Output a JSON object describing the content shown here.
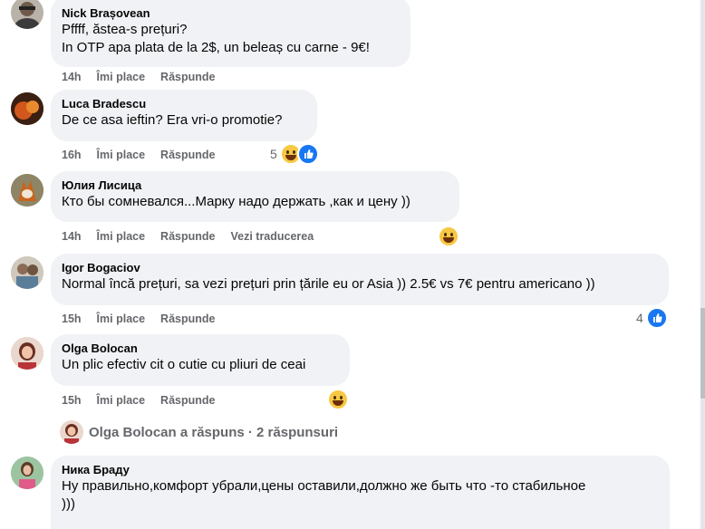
{
  "comments": [
    {
      "author": "Nick Brașovean",
      "lines": [
        "Pffff, ăstea-s prețuri?",
        "In OTP apa plata de la 2$, un beleaș cu carne - 9€!"
      ],
      "time": "14h",
      "like": "Îmi place",
      "reply": "Răspunde"
    },
    {
      "author": "Luca Bradescu",
      "lines": [
        "De ce asa ieftin? Era vri-o promotie?"
      ],
      "time": "16h",
      "like": "Îmi place",
      "reply": "Răspunde",
      "reaction_count": "5"
    },
    {
      "author": "Юлия Лисица",
      "lines": [
        "Кто бы сомневался...Марку надо держать ,как и цену ))"
      ],
      "time": "14h",
      "like": "Îmi place",
      "reply": "Răspunde",
      "translate": "Vezi traducerea"
    },
    {
      "author": "Igor Bogaciov",
      "lines": [
        "Normal încă prețuri, sa vezi prețuri prin țările eu or Asia )) 2.5€ vs 7€ pentru americano ))"
      ],
      "time": "15h",
      "like": "Îmi place",
      "reply": "Răspunde",
      "reaction_count": "4"
    },
    {
      "author": "Olga Bolocan",
      "lines": [
        "Un plic efectiv cit o cutie cu pliuri de ceai"
      ],
      "time": "15h",
      "like": "Îmi place",
      "reply": "Răspunde"
    },
    {
      "author": "Ника Браду",
      "lines": [
        "Ну правильно,комфорт убрали,цены оставили,должно же быть что -то стабильное",
        ")))"
      ]
    }
  ],
  "replies_summary": "Olga Bolocan a răspuns · 2 răspunsuri",
  "colors": {
    "bubble": "#f0f2f5",
    "meta": "#65676b",
    "like_blue": "#1877f2",
    "haha_yellow": "#f7c843"
  }
}
